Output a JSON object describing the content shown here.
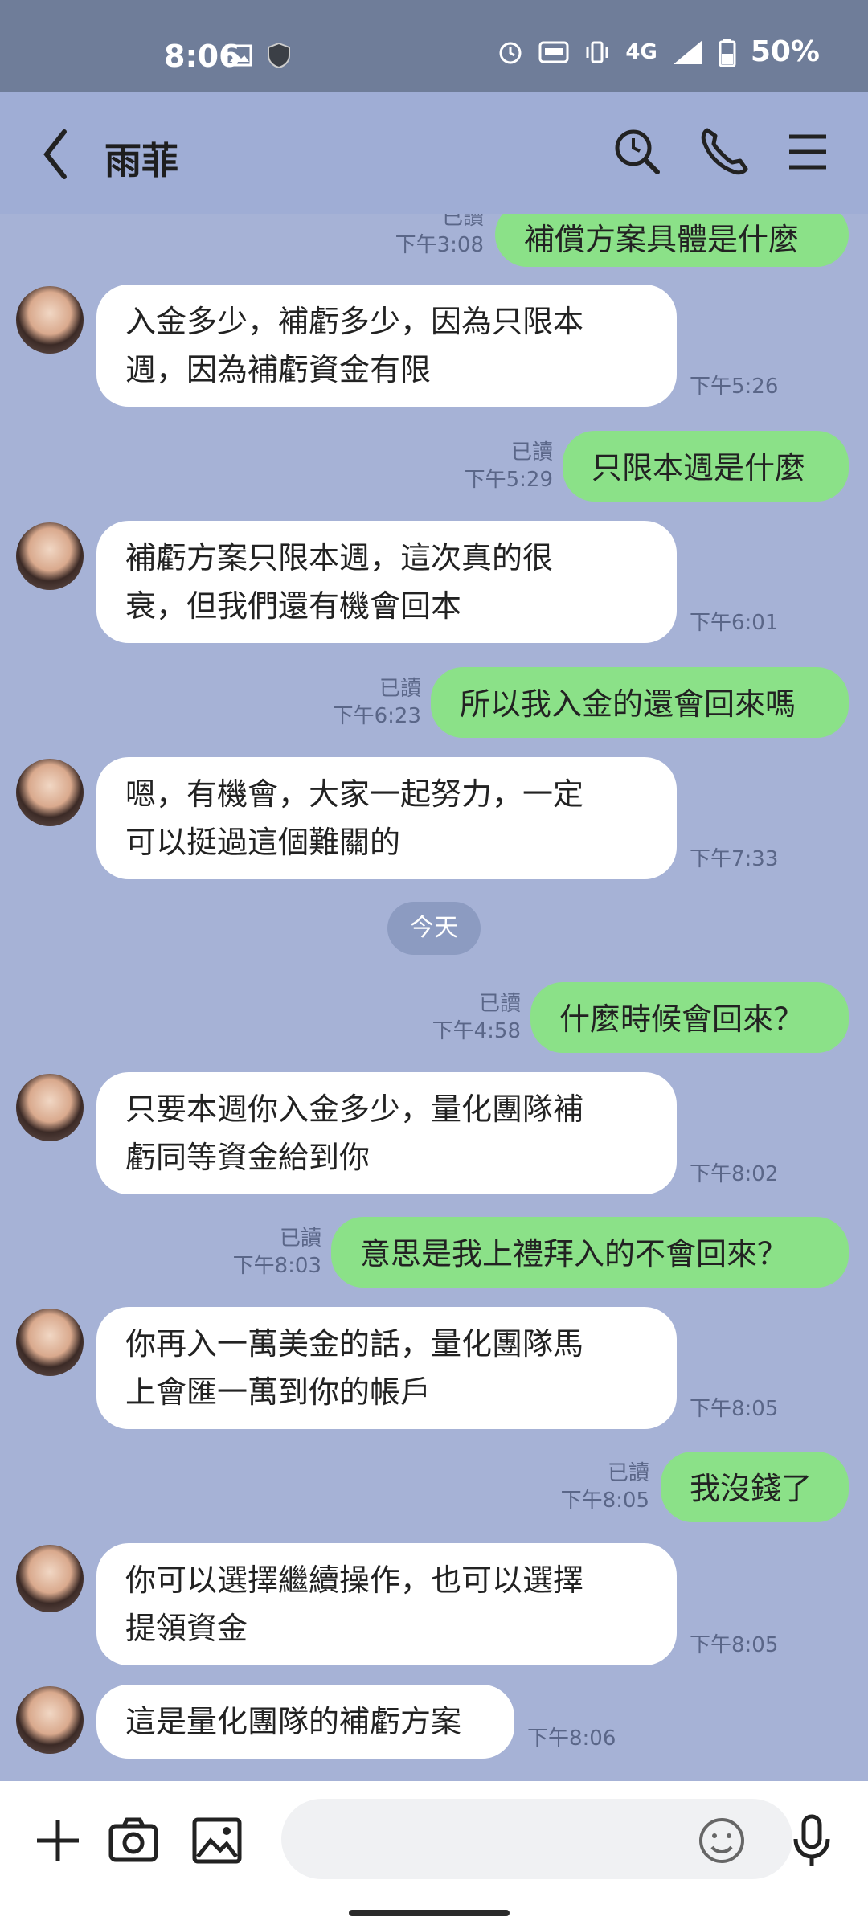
{
  "status": {
    "time": "8:06",
    "battery": "50%",
    "network": "4G"
  },
  "header": {
    "contact_name": "雨菲"
  },
  "chat": {
    "messages": [
      {
        "dir": "out",
        "text": "補償方案具體是什麼",
        "read": "已讀",
        "time": "下午3:08"
      },
      {
        "dir": "in",
        "text": "入金多少，補虧多少，因為只限本\n週，因為補虧資金有限",
        "time": "下午5:26"
      },
      {
        "dir": "out",
        "text": "只限本週是什麼",
        "read": "已讀",
        "time": "下午5:29"
      },
      {
        "dir": "in",
        "text": "補虧方案只限本週，這次真的很\n衰，但我們還有機會回本",
        "time": "下午6:01"
      },
      {
        "dir": "out",
        "text": "所以我入金的還會回來嗎",
        "read": "已讀",
        "time": "下午6:23"
      },
      {
        "dir": "in",
        "text": "嗯，有機會，大家一起努力，一定\n可以挺過這個難關的",
        "time": "下午7:33"
      },
      {
        "dir": "out",
        "text": "什麼時候會回來？",
        "read": "已讀",
        "time": "下午4:58"
      },
      {
        "dir": "in",
        "text": "只要本週你入金多少，量化團隊補\n虧同等資金給到你",
        "time": "下午8:02"
      },
      {
        "dir": "out",
        "text": "意思是我上禮拜入的不會回來？",
        "read": "已讀",
        "time": "下午8:03"
      },
      {
        "dir": "in",
        "text": "你再入一萬美金的話，量化團隊馬\n上會匯一萬到你的帳戶",
        "time": "下午8:05"
      },
      {
        "dir": "out",
        "text": "我沒錢了",
        "read": "已讀",
        "time": "下午8:05"
      },
      {
        "dir": "in",
        "text": "你可以選擇繼續操作，也可以選擇\n提領資金",
        "time": "下午8:05"
      },
      {
        "dir": "in",
        "text": "這是量化團隊的補虧方案",
        "time": "下午8:06"
      }
    ],
    "date_separator": "今天"
  },
  "input": {
    "value": "",
    "placeholder": ""
  }
}
